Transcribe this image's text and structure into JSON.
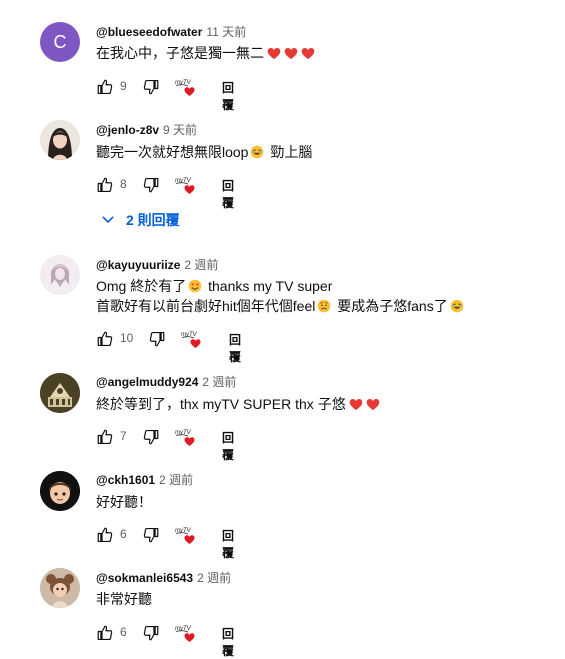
{
  "comments": [
    {
      "author": "@blueseedofwater",
      "time": "11 天前",
      "avatar_letter": "C",
      "avatar_color": "#7e57c2",
      "lines": [
        "在我心中，子悠是獨一無二"
      ],
      "likes": "9",
      "reply_label": "回覆"
    },
    {
      "author": "@jenlo-z8v",
      "time": "9 天前",
      "lines": [
        "聽完一次就好想無限loop",
        "勁上腦"
      ],
      "likes": "8",
      "reply_label": "回覆",
      "replies_toggle": "2 則回覆"
    },
    {
      "author": "@kayuyuuriize",
      "time": "2 週前",
      "lines": [
        "Omg 終於有了",
        "thanks my TV super",
        "首歌好有以前台劇好hit個年代個feel",
        "要成為子悠fans了"
      ],
      "likes": "10",
      "reply_label": "回覆"
    },
    {
      "author": "@angelmuddy924",
      "time": "2 週前",
      "lines": [
        "終於等到了，thx myTV SUPER thx 子悠"
      ],
      "likes": "7",
      "reply_label": "回覆"
    },
    {
      "author": "@ckh1601",
      "time": "2 週前",
      "lines": [
        "好好聽！"
      ],
      "likes": "6",
      "reply_label": "回覆"
    },
    {
      "author": "@sokmanlei6543",
      "time": "2 週前",
      "lines": [
        "非常好聽"
      ],
      "likes": "6",
      "reply_label": "回覆"
    }
  ],
  "icons": {
    "like": "thumb-up-icon",
    "dislike": "thumb-down-icon",
    "mytv": "mytv-heart-logo",
    "heart": "red-heart-emoji",
    "chevron": "chevron-down-icon"
  },
  "colors": {
    "accent_blue": "#065fd4",
    "heart_red": "#e53935",
    "meta_gray": "#606060"
  }
}
